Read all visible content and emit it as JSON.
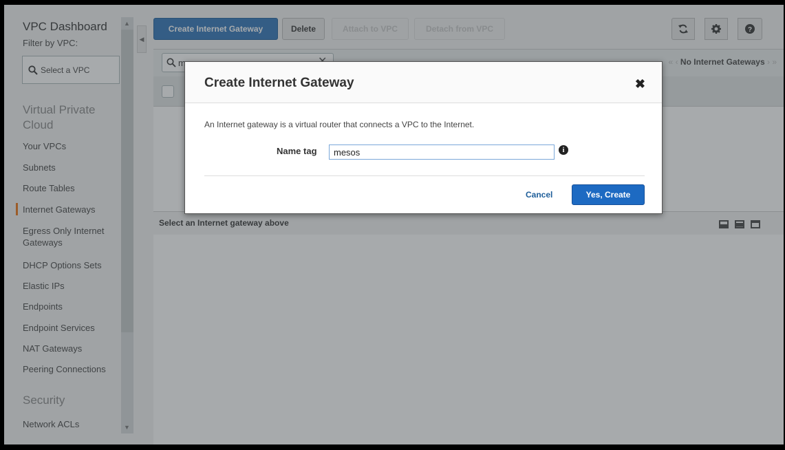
{
  "sidebar": {
    "title": "VPC Dashboard",
    "filter_label": "Filter by VPC:",
    "vpc_select_placeholder": "Select a VPC",
    "section_vpc": "Virtual Private Cloud",
    "items": [
      {
        "label": "Your VPCs"
      },
      {
        "label": "Subnets"
      },
      {
        "label": "Route Tables"
      },
      {
        "label": "Internet Gateways"
      },
      {
        "label": "Egress Only Internet Gateways"
      },
      {
        "label": "DHCP Options Sets"
      },
      {
        "label": "Elastic IPs"
      },
      {
        "label": "Endpoints"
      },
      {
        "label": "Endpoint Services"
      },
      {
        "label": "NAT Gateways"
      },
      {
        "label": "Peering Connections"
      }
    ],
    "section_security": "Security",
    "security_items": [
      {
        "label": "Network ACLs"
      }
    ],
    "active_item": "Internet Gateways",
    "active_color": "#ec7211"
  },
  "toolbar": {
    "create_label": "Create Internet Gateway",
    "delete_label": "Delete",
    "attach_label": "Attach to VPC",
    "detach_label": "Detach from VPC",
    "refresh_icon": "refresh-icon",
    "settings_icon": "gear-icon",
    "help_icon": "help-icon"
  },
  "list": {
    "search_value": "mesos",
    "pager_text": "No Internet Gateways",
    "detail_prompt": "Select an Internet gateway above"
  },
  "modal": {
    "title": "Create Internet Gateway",
    "description": "An Internet gateway is a virtual router that connects a VPC to the Internet.",
    "name_tag_label": "Name tag",
    "name_tag_value": "mesos",
    "cancel_label": "Cancel",
    "confirm_label": "Yes, Create",
    "primary_color": "#1d6ac2"
  }
}
